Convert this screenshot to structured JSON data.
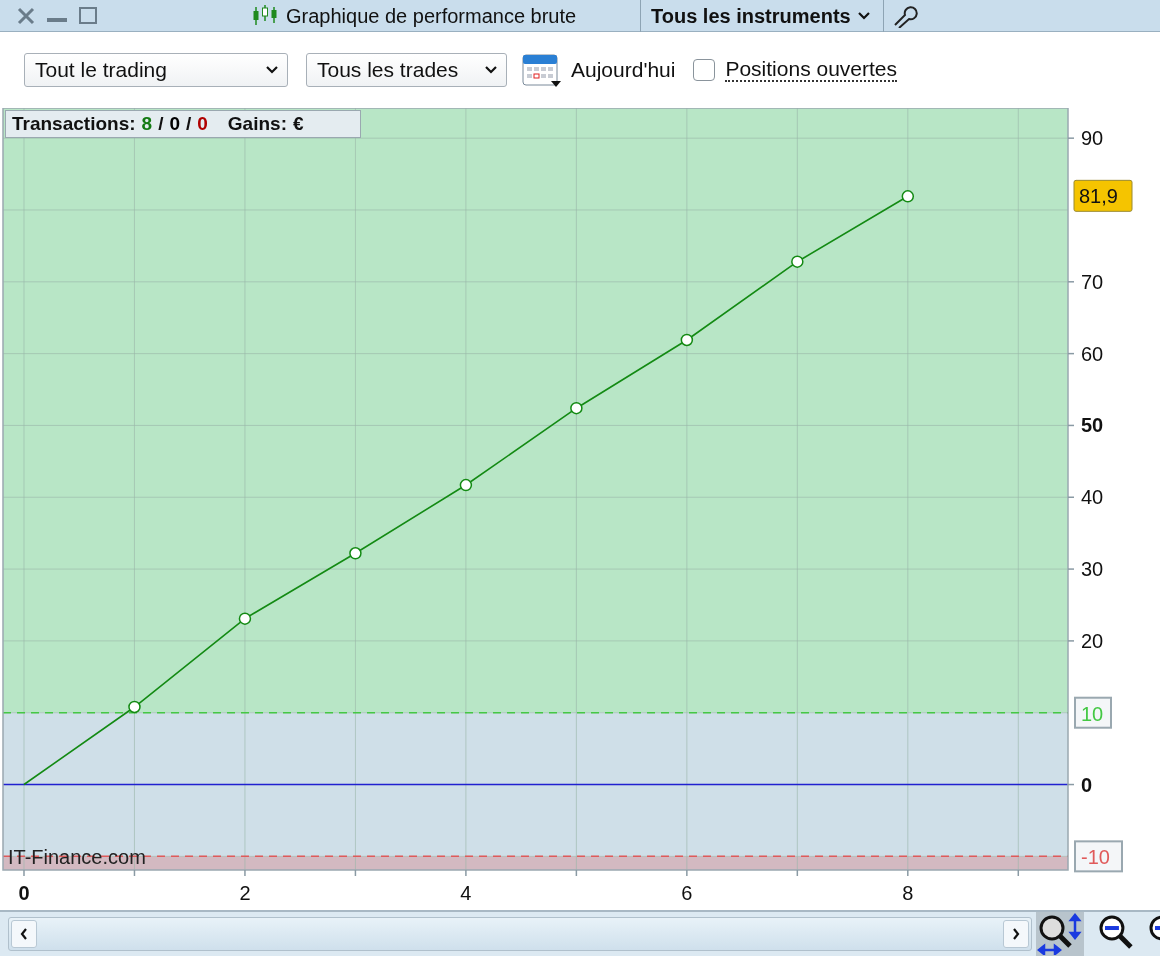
{
  "window": {
    "title": "Graphique de performance brute",
    "instrument_menu": "Tous les instruments"
  },
  "toolbar": {
    "scope_select": "Tout le trading",
    "trades_select": "Tous les trades",
    "date_label": "Aujourd'hui",
    "open_positions": {
      "label": "Positions ouvertes",
      "checked": false
    }
  },
  "summary": {
    "label": "Transactions:",
    "counts": [
      {
        "value": "8",
        "color": "#137a13"
      },
      {
        "value": "0",
        "color": "#000000"
      },
      {
        "value": "0",
        "color": "#b00000"
      }
    ],
    "separator": "/",
    "gains_label": "Gains:",
    "currency": "€"
  },
  "watermark": "IT-Finance.com",
  "chart_data": {
    "type": "line",
    "x": [
      0,
      1,
      2,
      3,
      4,
      5,
      6,
      7,
      8
    ],
    "series": [
      {
        "color": "#138a13",
        "marker": "circle",
        "values": [
          0,
          10.8,
          23.1,
          32.2,
          41.7,
          52.4,
          61.9,
          72.8,
          81.9
        ]
      }
    ],
    "xlim": [
      -0.19,
      9.45
    ],
    "ylim": [
      -11.9,
      94.2
    ],
    "grid": true,
    "xticks": [
      0,
      2,
      4,
      6,
      8
    ],
    "yticks": [
      0,
      20,
      30,
      40,
      50,
      60,
      70,
      90
    ],
    "bands": [
      {
        "axis": "y",
        "from": 10,
        "to": 94.2,
        "color": "#b8e6c6"
      },
      {
        "axis": "y",
        "from": -10,
        "to": 10,
        "color": "#cfdfe8"
      },
      {
        "axis": "y",
        "from": -11.9,
        "to": -10,
        "color": "#d3b9c1"
      }
    ],
    "ref_lines": [
      {
        "axis": "y",
        "value": 10,
        "label": "10",
        "color": "#44c844"
      },
      {
        "axis": "y",
        "value": 0,
        "color": "#2020d0"
      },
      {
        "axis": "y",
        "value": -10,
        "label": "-10",
        "color": "#e05a5a"
      }
    ],
    "annotations": [
      {
        "text": "81,9"
      }
    ]
  }
}
